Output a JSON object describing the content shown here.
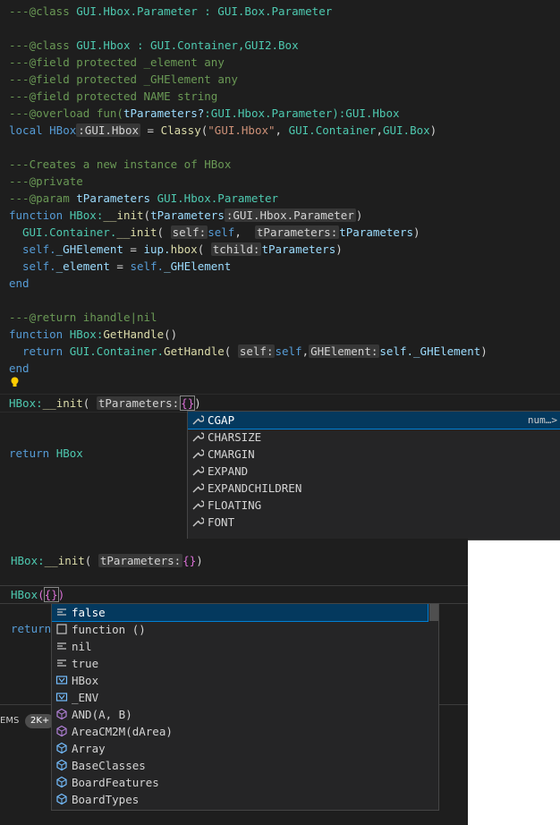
{
  "top_code": {
    "l1": {
      "a": "---@class ",
      "b": "GUI.Hbox.Parameter : GUI.Box.Parameter"
    },
    "l2": {
      "a": "---@class ",
      "b": "GUI.Hbox : GUI.Container,GUI2.Box"
    },
    "l3": {
      "a": "---@field ",
      "b": "protected ",
      "c": "_element any"
    },
    "l4": {
      "a": "---@field ",
      "b": "protected ",
      "c": "_GHElement any"
    },
    "l5": {
      "a": "---@field ",
      "b": "protected ",
      "c": "NAME string"
    },
    "l6": {
      "a": "---@overload ",
      "b": "fun(",
      "c": "tParameters?",
      "d": ":GUI.Hbox.Parameter):GUI.Hbox"
    },
    "l7": {
      "kw": "local ",
      "name": "HBox",
      "hint": ":GUI.Hbox",
      "eq": " = ",
      "fn": "Classy",
      "open": "(",
      "str": "\"GUI.Hbox\"",
      "sep": ", ",
      "c1": "GUI.Container",
      "c": ",",
      "c2": "GUI.Box",
      "close": ")"
    },
    "l8": "---Creates a new instance of HBox",
    "l9": "---@private",
    "l10": {
      "a": "---@param ",
      "b": "tParameters ",
      "c": "GUI.Hbox.Parameter"
    },
    "l11": {
      "kw": "function ",
      "a": "HBox:",
      "fn": "__init",
      "open": "(",
      "arg": "tParameters",
      "hint": ":GUI.Hbox.Parameter",
      "close": ")"
    },
    "l12": {
      "a": "GUI.Container.",
      "fn": "__init",
      "open": "( ",
      "h1": "self:",
      "v1": "self",
      "sep": ",  ",
      "h2": "tParameters:",
      "v2": "tParameters",
      "close": ")"
    },
    "l13": {
      "a": "self.",
      "b": "_GHElement",
      "eq": " = ",
      "c": "iup.",
      "fn": "hbox",
      "open": "( ",
      "h": "tchild:",
      "v": "tParameters",
      "close": ")"
    },
    "l14": {
      "a": "self.",
      "b": "_element",
      "eq": " = ",
      "c": "self.",
      "d": "_GHElement"
    },
    "l15": "end",
    "l16": {
      "a": "---@return ",
      "b": "ihandle|nil"
    },
    "l17": {
      "kw": "function ",
      "a": "HBox:",
      "fn": "GetHandle",
      "p": "()"
    },
    "l18": {
      "kw": "return ",
      "a": "GUI.Container.",
      "fn": "GetHandle",
      "open": "( ",
      "h1": "self:",
      "v1": "self",
      "sep": ",",
      "h2": "GHElement:",
      "v2": "self._GHElement",
      "close": ")"
    },
    "l19": "end",
    "l20": {
      "a": "HBox:",
      "fn": "__init",
      "open": "( ",
      "h": "tParameters:",
      "br": "{}",
      "close": ")"
    },
    "l21": {
      "kw": "return ",
      "a": "HBox"
    }
  },
  "top_suggest": {
    "items": [
      "CGAP",
      "CHARSIZE",
      "CMARGIN",
      "EXPAND",
      "EXPANDCHILDREN",
      "FLOATING",
      "FONT"
    ],
    "detail": "num…>"
  },
  "bottom_code": {
    "l1": {
      "a": "HBox:",
      "fn": "__init",
      "open": "( ",
      "h": "tParameters:",
      "br": "{}",
      "close": ")"
    },
    "l2": {
      "a": "HBox",
      "open": "(",
      "br": "{}",
      "close": ")"
    },
    "l3": "return"
  },
  "bottom_suggest": {
    "items": [
      "false",
      "function ()",
      "nil",
      "true",
      "HBox",
      "_ENV",
      "AND(A, B)",
      "AreaCM2M(dArea)",
      "Array",
      "BaseClasses",
      "BoardFeatures",
      "BoardTypes"
    ],
    "icons": [
      "keyword-icon",
      "snippet-icon",
      "keyword-icon",
      "keyword-icon",
      "variable-icon",
      "variable-icon",
      "method-icon",
      "method-icon",
      "module-icon",
      "module-icon",
      "module-icon",
      "module-icon"
    ]
  },
  "status": {
    "problems_label": "EMS",
    "badge": "2K+"
  },
  "colors": {
    "editor_bg": "#1e1e1e",
    "suggest_bg": "#252526",
    "selection": "#04395e",
    "accent": "#007fd4"
  }
}
